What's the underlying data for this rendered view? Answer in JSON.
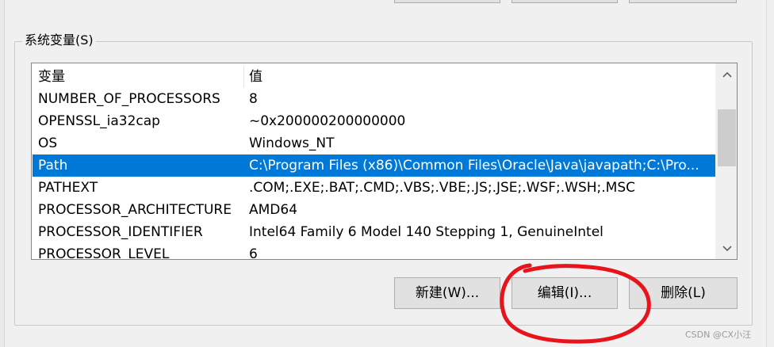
{
  "group": {
    "legend": "系统变量(S)"
  },
  "list": {
    "headers": {
      "variable": "变量",
      "value": "值"
    },
    "rows": [
      {
        "variable": "NUMBER_OF_PROCESSORS",
        "value": "8"
      },
      {
        "variable": "OPENSSL_ia32cap",
        "value": "~0x200000200000000"
      },
      {
        "variable": "OS",
        "value": "Windows_NT"
      },
      {
        "variable": "Path",
        "value": "C:\\Program Files (x86)\\Common Files\\Oracle\\Java\\javapath;C:\\Pro..."
      },
      {
        "variable": "PATHEXT",
        "value": ".COM;.EXE;.BAT;.CMD;.VBS;.VBE;.JS;.JSE;.WSF;.WSH;.MSC"
      },
      {
        "variable": "PROCESSOR_ARCHITECTURE",
        "value": "AMD64"
      },
      {
        "variable": "PROCESSOR_IDENTIFIER",
        "value": "Intel64 Family 6 Model 140 Stepping 1, GenuineIntel"
      },
      {
        "variable": "PROCESSOR_LEVEL",
        "value": "6"
      }
    ],
    "selected_variable": "Path"
  },
  "buttons": {
    "new_label": "新建(W)...",
    "edit_label": "编辑(I)...",
    "delete_label": "删除(L)"
  },
  "watermark": "CSDN @CX小汪",
  "colors": {
    "selection": "#0078d7",
    "annotation": "#e8141c"
  },
  "icons": {
    "scroll_up": "chevron-up-icon",
    "scroll_down": "chevron-down-icon"
  }
}
